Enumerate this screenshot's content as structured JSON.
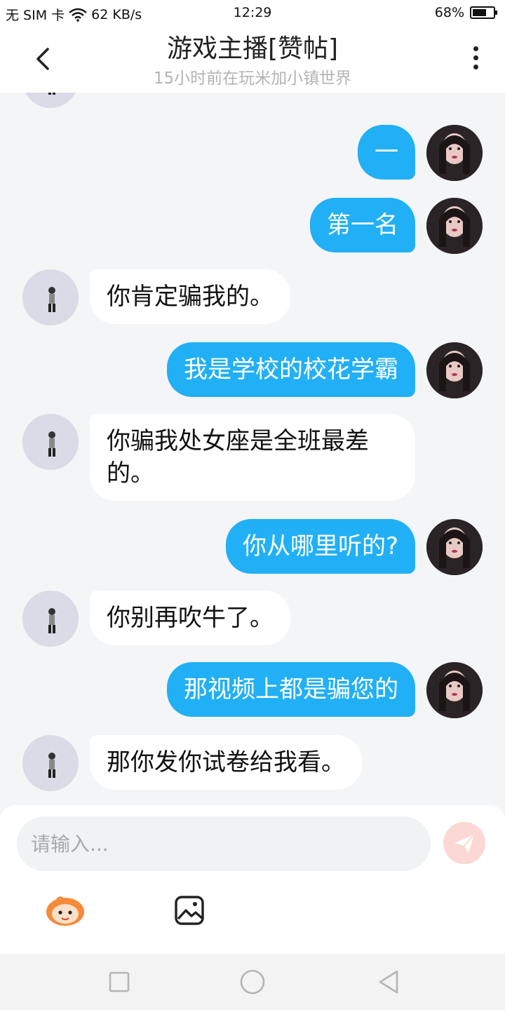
{
  "status_bar": {
    "carrier": "无 SIM 卡",
    "net_speed": "62 KB/s",
    "time": "12:29",
    "battery": "68%",
    "battery_level": 0.68
  },
  "header": {
    "title": "游戏主播[赞帖]",
    "subtitle": "15小时前在玩米加小镇世界"
  },
  "messages": [
    {
      "from": "me",
      "text": "一"
    },
    {
      "from": "me",
      "text": "第一名"
    },
    {
      "from": "other",
      "text": "你肯定骗我的。"
    },
    {
      "from": "me",
      "text": "我是学校的校花学霸"
    },
    {
      "from": "other",
      "text": "你骗我处女座是全班最差的。"
    },
    {
      "from": "me",
      "text": "你从哪里听的?"
    },
    {
      "from": "other",
      "text": "你别再吹牛了。"
    },
    {
      "from": "me",
      "text": "那视频上都是骗您的"
    },
    {
      "from": "other",
      "text": "那你发你试卷给我看。"
    }
  ],
  "input": {
    "placeholder": "请输入..."
  },
  "icons": {
    "back": "chevron-left-icon",
    "more": "more-vertical-icon",
    "send": "send-icon",
    "emoji": "emoji-mascot-icon",
    "image": "image-icon",
    "nav_recent": "square-icon",
    "nav_home": "circle-icon",
    "nav_back": "triangle-back-icon"
  },
  "colors": {
    "my_bubble": "#21b0f5",
    "other_bubble": "#ffffff",
    "chat_background": "#f4f5f7",
    "send_button": "#fbd8d3"
  }
}
